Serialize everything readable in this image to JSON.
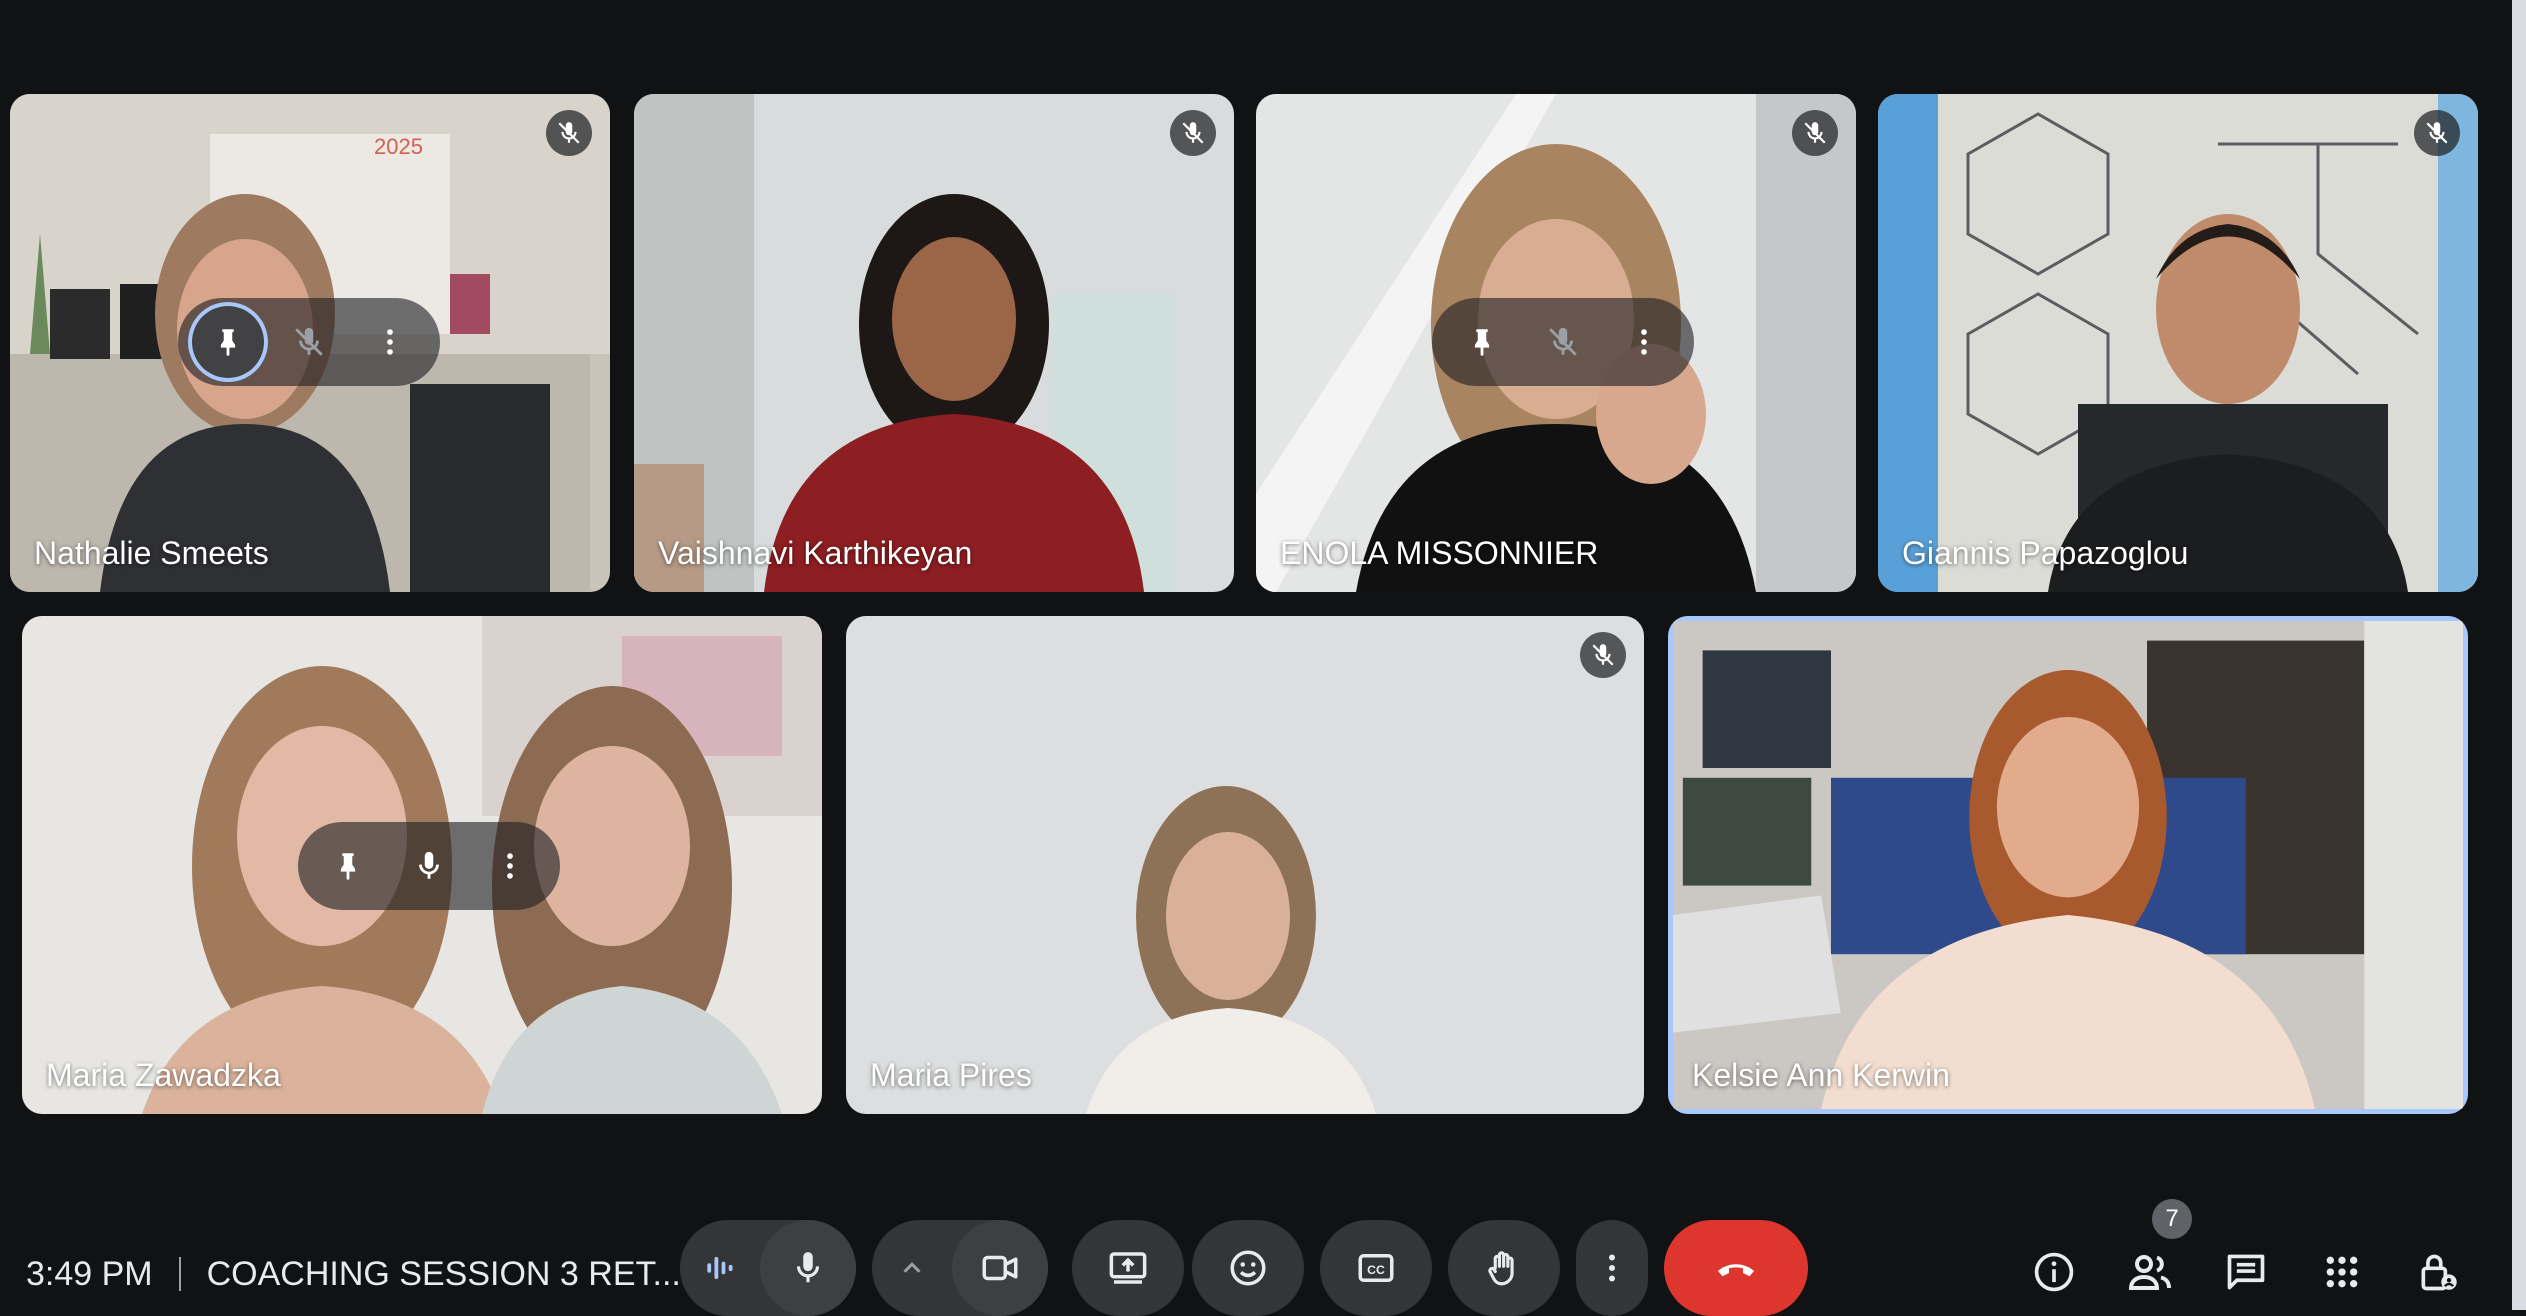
{
  "participants": [
    {
      "name": "Nathalie Smeets",
      "muted": true
    },
    {
      "name": "Vaishnavi Karthikeyan",
      "muted": true
    },
    {
      "name": "ENOLA MISSONNIER",
      "muted": true
    },
    {
      "name": "Giannis Papazoglou",
      "muted": true
    },
    {
      "name": "Maria Zawadzka",
      "muted": false
    },
    {
      "name": "Maria Pires",
      "muted": true
    },
    {
      "name": "Kelsie Ann Kerwin",
      "muted": false,
      "active_speaker": true
    }
  ],
  "wall_calendar_year": "2025",
  "meeting": {
    "time": "3:49 PM",
    "title": "COACHING SESSION 3 RET..."
  },
  "controls": {
    "people_count": "7"
  },
  "icons": {
    "mic_off": "mic-off-icon",
    "pin": "pin-icon",
    "more": "more-vert-icon",
    "mic": "mic-icon",
    "camera": "videocam-icon",
    "present": "present-screen-icon",
    "emoji": "emoji-icon",
    "captions": "closed-captions-icon",
    "raise_hand": "raise-hand-icon",
    "end_call": "end-call-icon",
    "info": "info-icon",
    "people": "people-icon",
    "chat": "chat-icon",
    "activities": "apps-grid-icon",
    "host_controls": "host-controls-lock-icon"
  },
  "colors": {
    "background": "#111214",
    "control": "#333537",
    "end_call": "#dc362e",
    "active_border": "#a8c7fa"
  }
}
